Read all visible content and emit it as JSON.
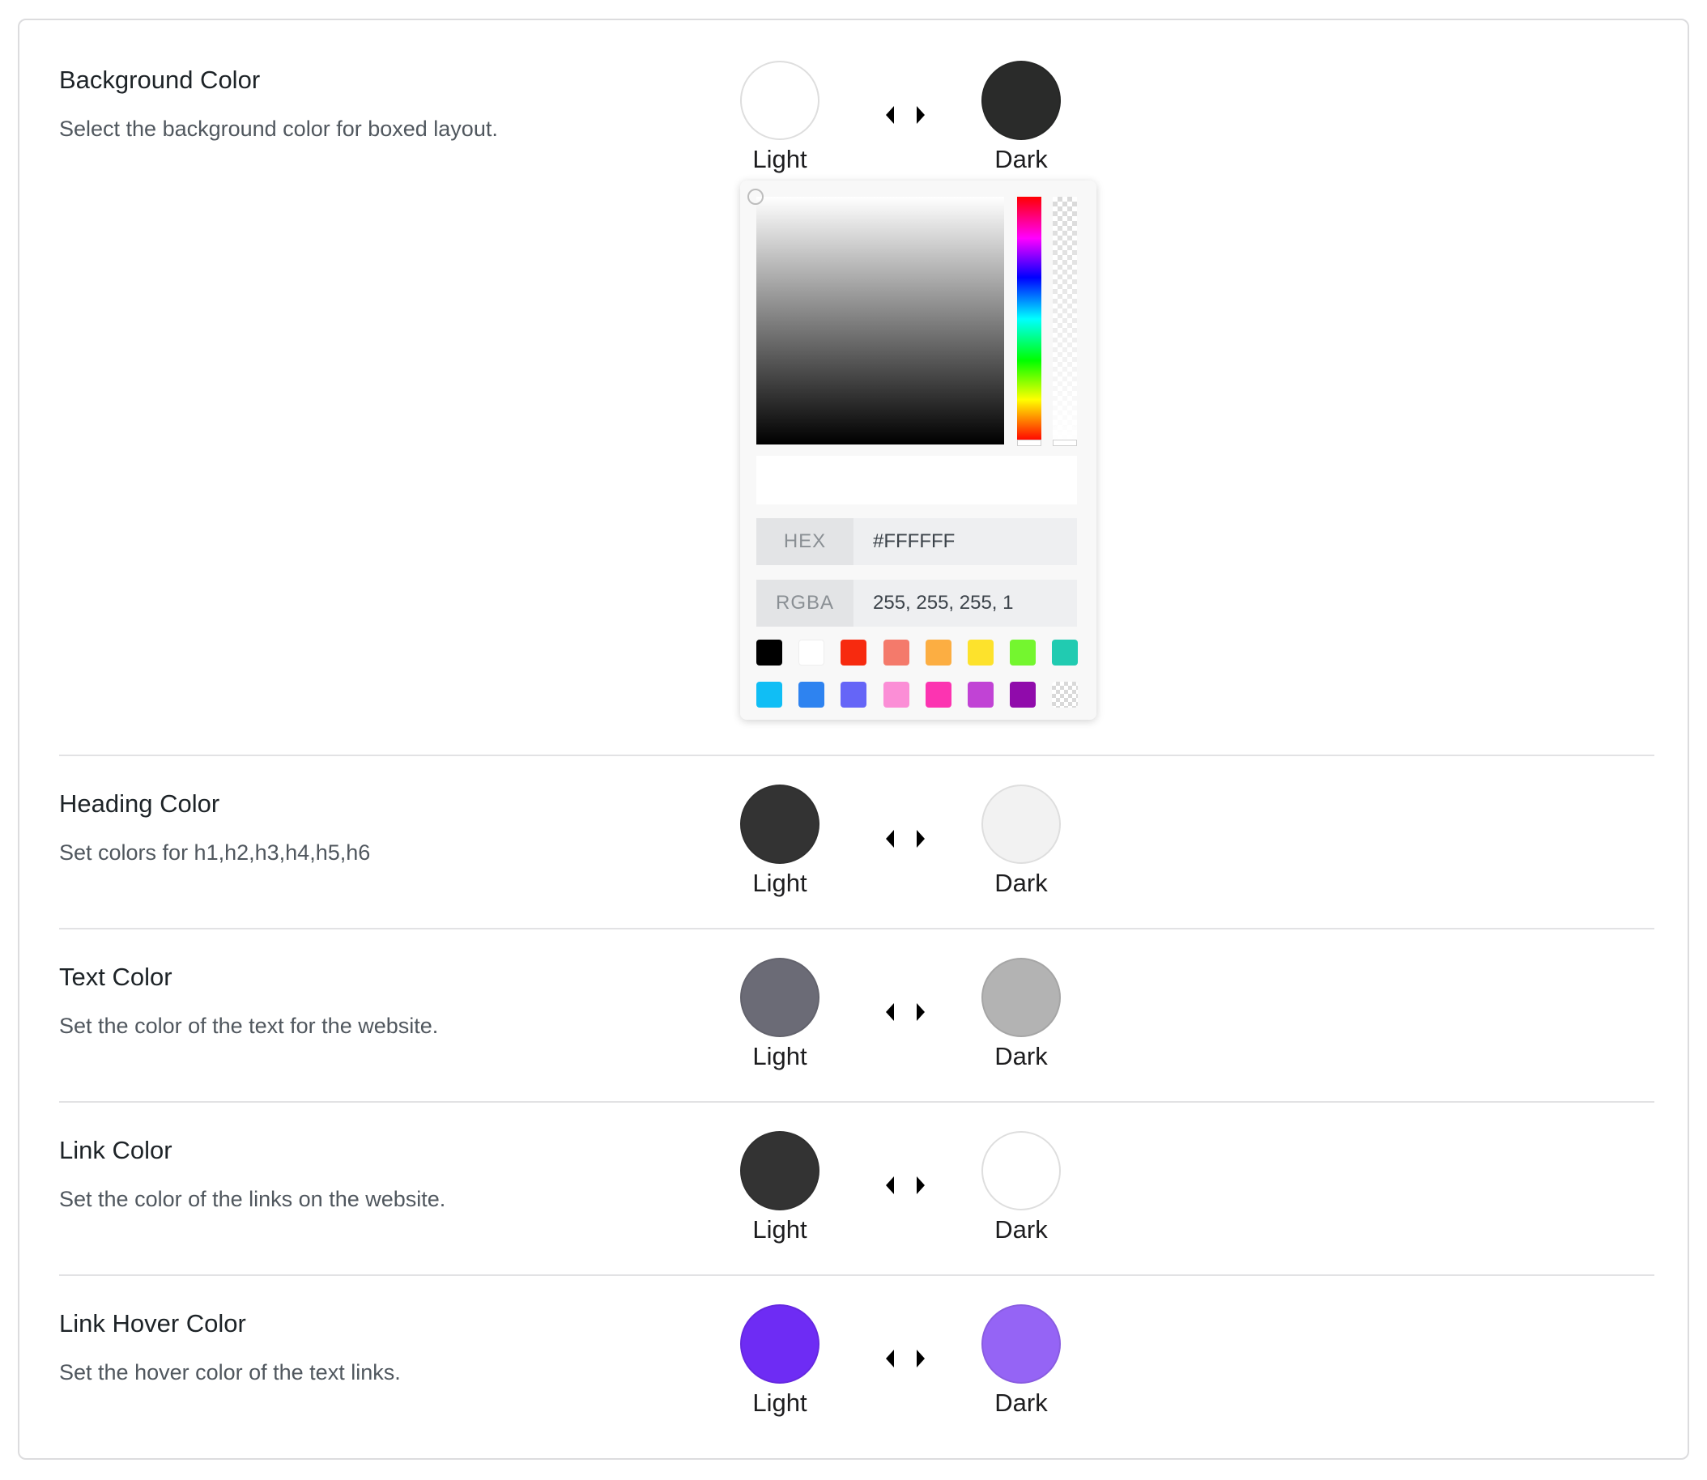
{
  "rows": [
    {
      "title": "Background Color",
      "description": "Select the background color for boxed layout.",
      "light": {
        "label": "Light",
        "color": "#ffffff"
      },
      "dark": {
        "label": "Dark",
        "color": "#2a2b2a"
      }
    },
    {
      "title": "Heading Color",
      "description": "Set colors for h1,h2,h3,h4,h5,h6",
      "light": {
        "label": "Light",
        "color": "#333333"
      },
      "dark": {
        "label": "Dark",
        "color": "#f2f2f2"
      }
    },
    {
      "title": "Text Color",
      "description": "Set the color of the text for the website.",
      "light": {
        "label": "Light",
        "color": "#6b6b76"
      },
      "dark": {
        "label": "Dark",
        "color": "#b3b3b3"
      }
    },
    {
      "title": "Link Color",
      "description": "Set the color of the links on the website.",
      "light": {
        "label": "Light",
        "color": "#333333"
      },
      "dark": {
        "label": "Dark",
        "color": "#ffffff"
      }
    },
    {
      "title": "Link Hover Color",
      "description": "Set the hover color of the text links.",
      "light": {
        "label": "Light",
        "color": "#6e2cf4"
      },
      "dark": {
        "label": "Dark",
        "color": "#9564f5"
      }
    }
  ],
  "picker": {
    "hex_label": "HEX",
    "hex_value": "#FFFFFF",
    "rgba_label": "RGBA",
    "rgba_value": "255, 255, 255, 1",
    "presets": [
      "#000000",
      "#ffffff",
      "#f72a0f",
      "#f47a6b",
      "#fcae42",
      "#fde22c",
      "#74f62f",
      "#21cbb1",
      "#10bef5",
      "#2e83f0",
      "#6565f7",
      "#fb8ed6",
      "#fc34b1",
      "#c143d5",
      "#900bab",
      "transparent"
    ]
  }
}
